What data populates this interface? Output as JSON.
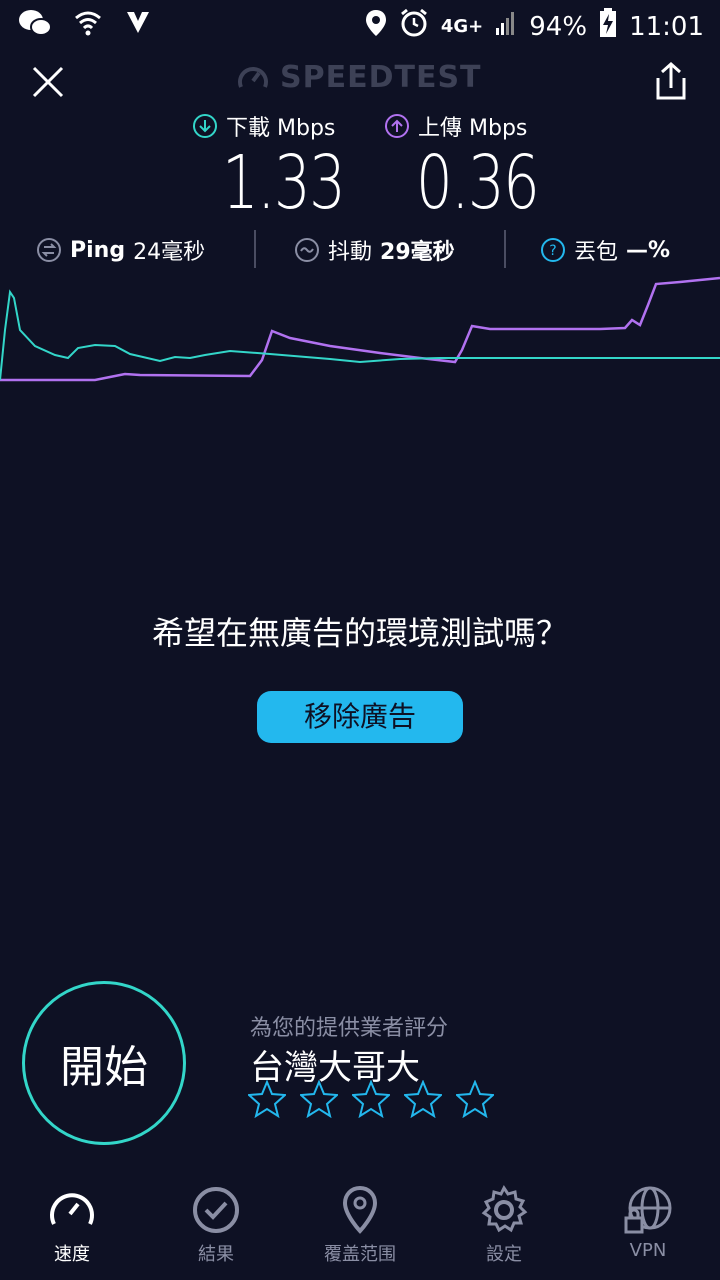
{
  "status_bar": {
    "battery": "94%",
    "time": "11:01",
    "network": "4G+"
  },
  "header": {
    "logo_text": "SPEEDTEST"
  },
  "metrics": {
    "download_label": "下載 Mbps",
    "upload_label": "上傳 Mbps",
    "download_value": "1.33",
    "upload_value": "0.36",
    "ping_label": "Ping",
    "ping_value": "24毫秒",
    "jitter_label": "抖動",
    "jitter_value": "29毫秒",
    "loss_label": "丟包",
    "loss_value": "—%"
  },
  "ad": {
    "question": "希望在無廣告的環境測試嗎？",
    "remove_button": "移除廣告"
  },
  "start": {
    "label": "開始"
  },
  "provider": {
    "rate_label": "為您的提供業者評分",
    "name": "台灣大哥大"
  },
  "nav": {
    "items": [
      {
        "label": "速度",
        "icon": "speed-gauge-icon"
      },
      {
        "label": "結果",
        "icon": "check-circle-icon"
      },
      {
        "label": "覆盖范围",
        "icon": "map-pin-icon"
      },
      {
        "label": "設定",
        "icon": "gear-icon"
      },
      {
        "label": "VPN",
        "icon": "globe-lock-icon"
      }
    ]
  },
  "colors": {
    "background": "#0e1124",
    "download": "#33d6c9",
    "upload": "#b172f0",
    "accent": "#23b8ee"
  }
}
